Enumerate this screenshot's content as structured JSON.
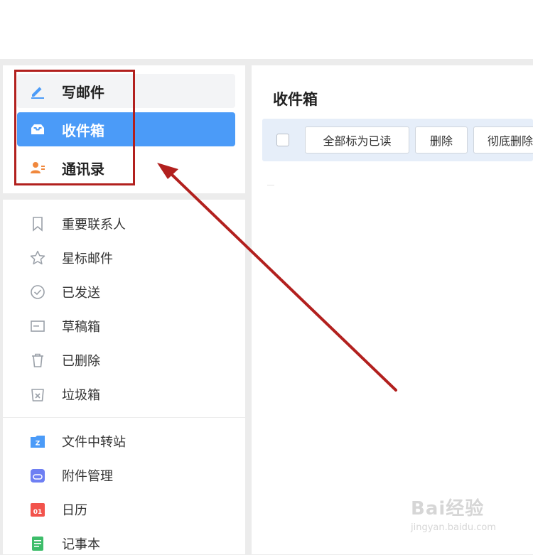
{
  "primary_nav": [
    {
      "label": "写邮件",
      "icon": "compose-pen-icon"
    },
    {
      "label": "收件箱",
      "icon": "inbox-tray-icon",
      "active": true
    },
    {
      "label": "通讯录",
      "icon": "contacts-card-icon"
    }
  ],
  "folders": [
    {
      "label": "重要联系人",
      "icon": "bookmark-icon"
    },
    {
      "label": "星标邮件",
      "icon": "star-icon"
    },
    {
      "label": "已发送",
      "icon": "check-circle-icon"
    },
    {
      "label": "草稿箱",
      "icon": "draft-icon"
    },
    {
      "label": "已删除",
      "icon": "trash-icon"
    },
    {
      "label": "垃圾箱",
      "icon": "spam-bin-icon"
    }
  ],
  "apps": [
    {
      "label": "文件中转站",
      "icon": "file-transfer-icon",
      "glyph": "Z"
    },
    {
      "label": "附件管理",
      "icon": "attachment-icon"
    },
    {
      "label": "日历",
      "icon": "calendar-icon",
      "glyph": "01"
    },
    {
      "label": "记事本",
      "icon": "notepad-icon"
    }
  ],
  "main": {
    "title": "收件箱",
    "toolbar": {
      "mark_all_read": "全部标为已读",
      "delete": "删除",
      "permanent_delete": "彻底删除"
    }
  },
  "watermark": {
    "brand": "Bai经验",
    "url": "jingyan.baidu.com"
  },
  "colors": {
    "accent_blue": "#4b9bf8",
    "annotation_red": "#b2201e",
    "toolbar_bg": "#e6eef9",
    "contacts_orange": "#f0883d",
    "calendar_red": "#f2534c",
    "notepad_green": "#3dbd6a",
    "attachment_purple": "#6e7ff3"
  }
}
